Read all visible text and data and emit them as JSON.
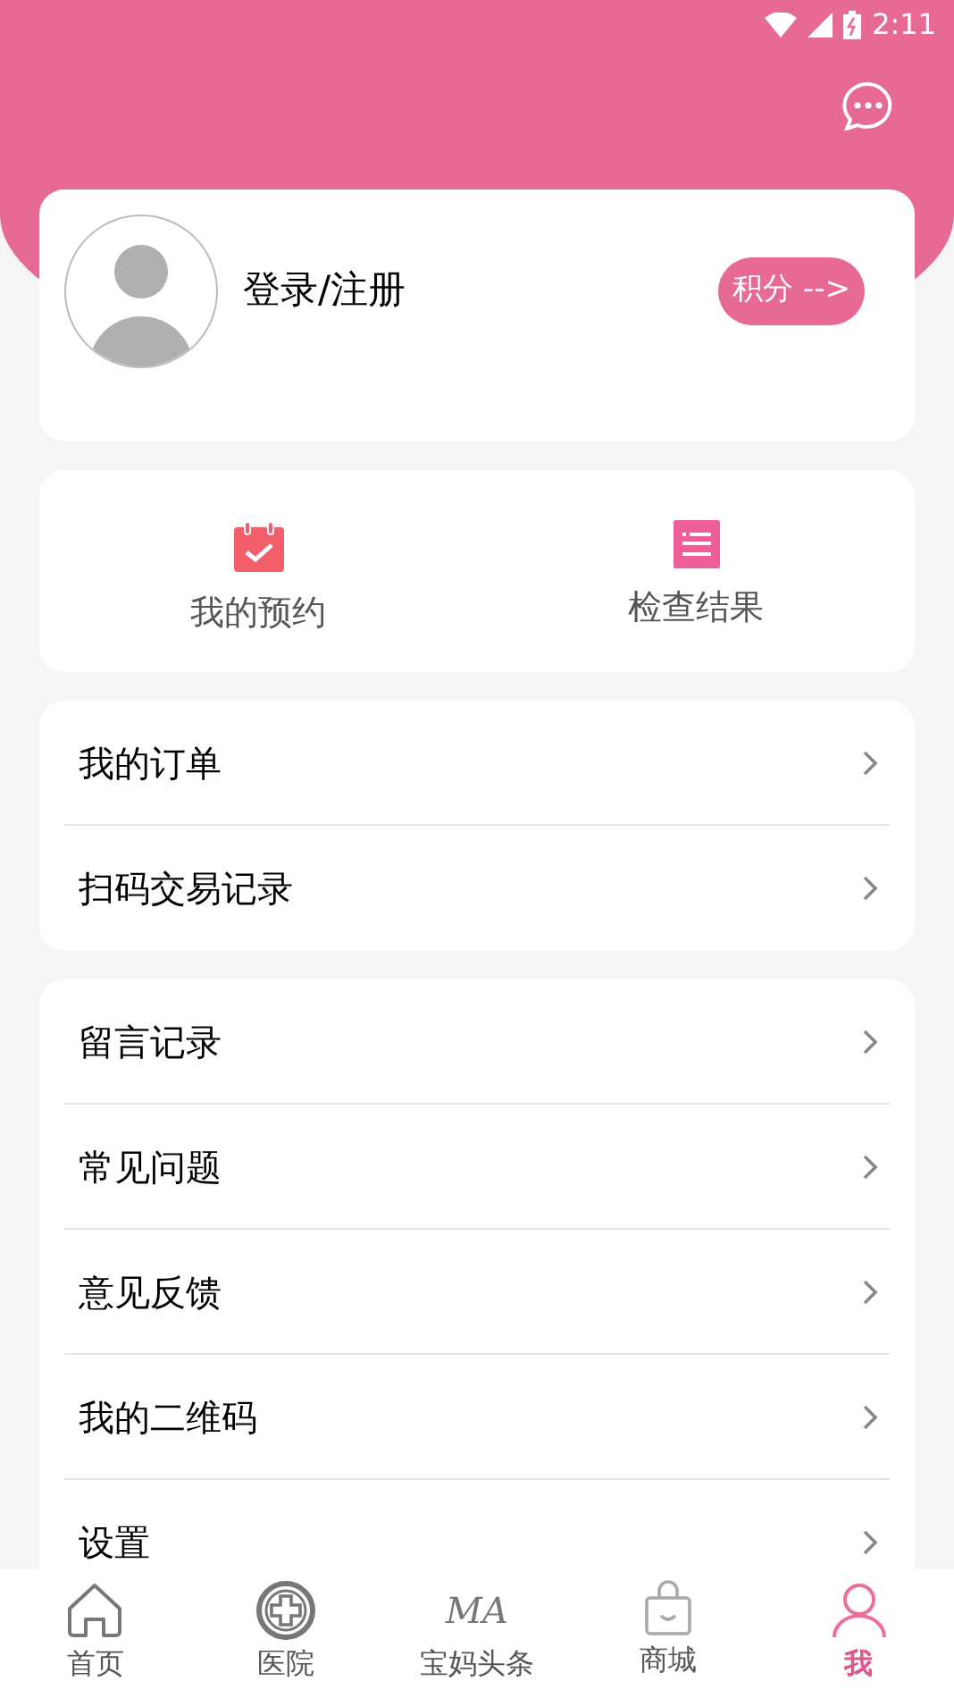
{
  "status_bar": {
    "time": "2:11"
  },
  "profile": {
    "name": "登录/注册",
    "points_button": "积分 -->"
  },
  "shortcuts": [
    {
      "kind": "calendar",
      "label": "我的预约"
    },
    {
      "kind": "list",
      "label": "检查结果"
    }
  ],
  "menu_groups": [
    {
      "items": [
        "我的订单",
        "扫码交易记录"
      ]
    },
    {
      "items": [
        "留言记录",
        "常见问题",
        "意见反馈",
        "我的二维码",
        "设置"
      ]
    }
  ],
  "tab_bar": [
    {
      "kind": "home",
      "label": "首页",
      "selected": false
    },
    {
      "kind": "hospital",
      "label": "医院",
      "selected": false
    },
    {
      "kind": "logo",
      "logo_text": "MA",
      "label": "宝妈头条",
      "selected": false
    },
    {
      "kind": "shop",
      "label": "商城",
      "selected": false
    },
    {
      "kind": "person",
      "label": "我",
      "selected": true
    }
  ]
}
